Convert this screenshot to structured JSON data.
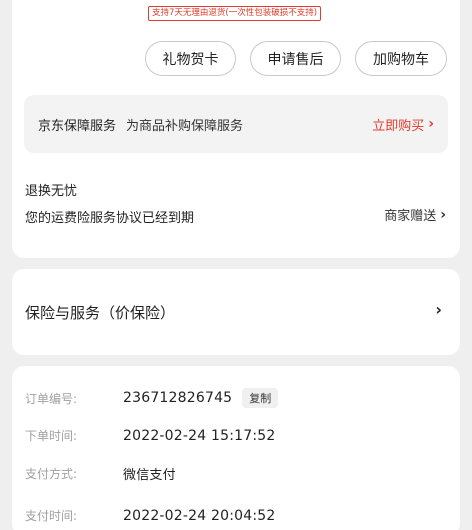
{
  "return_policy_note": "支持7天无理由退货(一次性包装破损不支持)",
  "actions": {
    "gift_card": "礼物贺卡",
    "after_sale": "申请售后",
    "add_to_cart": "加购物车"
  },
  "jd_service": {
    "title": "京东保障服务",
    "subtitle": "为商品补购保障服务",
    "buy_label": "立即购买",
    "buy_chevron": "›"
  },
  "return_worry_free": {
    "title": "退换无忧",
    "description": "您的运费险服务协议已经到期",
    "merchant_gift": "商家赠送",
    "chevron": "›"
  },
  "insurance": {
    "label": "保险与服务（价保险）",
    "chevron": "›"
  },
  "order_info": {
    "order_no_label": "订单编号:",
    "order_no": "236712826745",
    "copy_label": "复制",
    "order_time_label": "下单时间:",
    "order_time": "2022-02-24 15:17:52",
    "payment_method_label": "支付方式:",
    "payment_method": "微信支付",
    "payment_time_label": "支付时间:",
    "payment_time": "2022-02-24 20:04:52"
  },
  "colors": {
    "accent_red": "#e03b2c",
    "page_bg": "#efefef",
    "card_bg": "#ffffff"
  }
}
